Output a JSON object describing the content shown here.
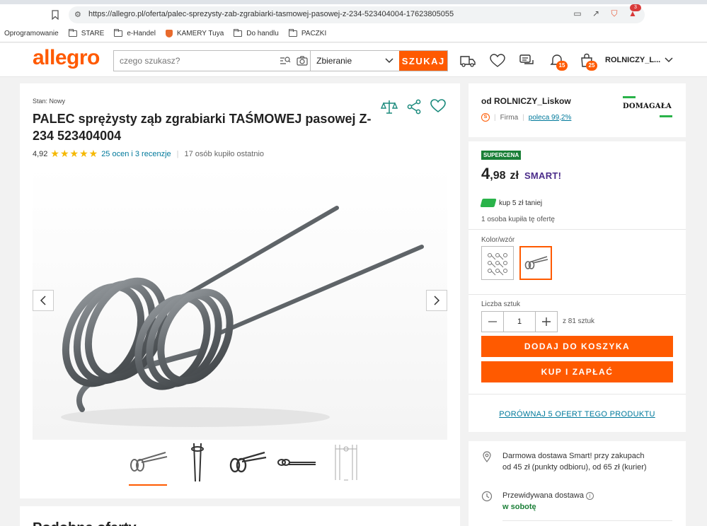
{
  "browser": {
    "url": "https://allegro.pl/oferta/palec-sprezysty-zab-zgrabiarki-tasmowej-pasowej-z-234-523404004-17623805055",
    "alert_count": "3"
  },
  "bookmarks": [
    "Oprogramowanie",
    "STARE",
    "e-Handel",
    "KAMERY Tuya",
    "Do handlu",
    "PACZKI"
  ],
  "header": {
    "logo": "allegro",
    "search_placeholder": "czego szukasz?",
    "category": "Zbieranie",
    "search_button": "SZUKAJ",
    "notifications_count": "15",
    "cart_count": "25",
    "account_name": "ROLNICZY_L..."
  },
  "product": {
    "condition_label": "Stan:",
    "condition_value": "Nowy",
    "title": "PALEC sprężysty ząb zgrabiarki TAŚMOWEJ pasowej Z-234 523404004",
    "rating": "4,92",
    "stars": "★★★★★",
    "reviews": "25 ocen i 3 recenzje",
    "bought_recently": "17 osób kupiło ostatnio",
    "thumbnails_count": 5,
    "active_thumbnail": 0
  },
  "next_section_title": "Podobne oferty",
  "seller": {
    "name": "od ROLNICZY_Liskow",
    "type": "Firma",
    "recommend": "poleca 99,2%",
    "brand": "DOMAGAŁA"
  },
  "offer": {
    "badge": "SUPERCENA",
    "price_main": "4",
    "price_fraction": ",98",
    "currency": "zł",
    "smart_label": "SMART!",
    "promo": "kup 5 zł taniej",
    "bought_info": "1 osoba kupiła tę ofertę",
    "variant_label": "Kolor/wzór",
    "quantity_label": "Liczba sztuk",
    "quantity": "1",
    "quantity_of": "z 81 sztuk",
    "add_to_cart": "DODAJ DO KOSZYKA",
    "buy_now": "KUP I ZAPŁAĆ",
    "compare_link": "PORÓWNAJ 5 OFERT TEGO PRODUKTU"
  },
  "delivery": {
    "free_line1": "Darmowa dostawa Smart! przy zakupach",
    "free_line2": "od 45 zł (punkty odbioru), od 65 zł (kurier)",
    "expected_label": "Przewidywana dostawa",
    "expected_value": "w sobotę"
  },
  "colors": {
    "brand_orange": "#ff5a00",
    "link_teal": "#00799b",
    "supercena_green": "#1a7f37",
    "star_yellow": "#f5b800"
  }
}
